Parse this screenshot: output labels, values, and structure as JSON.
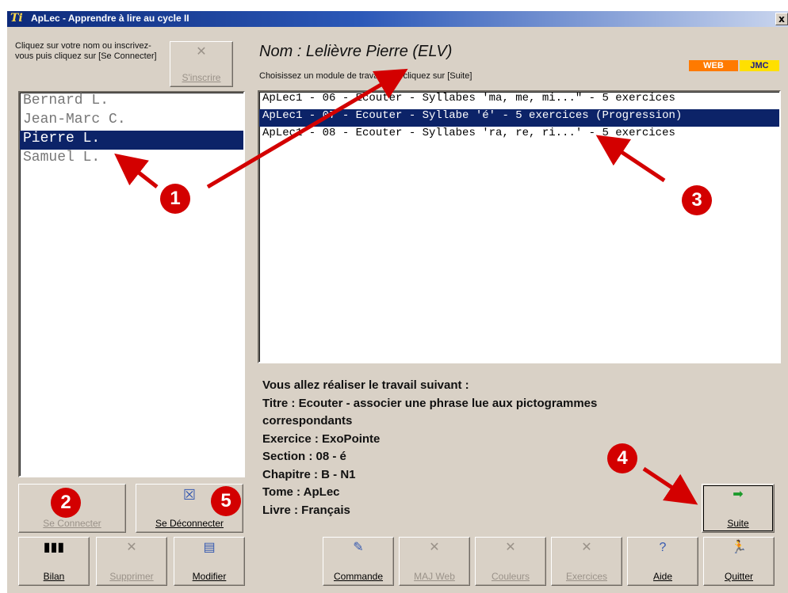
{
  "window": {
    "title": "ApLec - Apprendre à lire au cycle II",
    "close": "x"
  },
  "left_panel": {
    "instruction": "Cliquez sur votre nom ou inscrivez-vous puis cliquez sur [Se Connecter]",
    "inscrire_button": "S'inscrire",
    "users": [
      "Bernard L.",
      "Jean-Marc C.",
      "Pierre L.",
      "Samuel L."
    ],
    "selected_index": 2,
    "connect_button": "Se Connecter",
    "disconnect_button": "Se Déconnecter"
  },
  "header": {
    "nom": "Nom : Lelièvre Pierre (ELV)",
    "instruction": "Choisissez un module de travail puis cliquez sur [Suite]",
    "badge_web": "WEB",
    "badge_jmc": "JMC"
  },
  "modules": {
    "items": [
      "ApLec1 - 06 - Ecouter - Syllabes 'ma, me, mi...\" - 5 exercices",
      "ApLec1 - 07 - Ecouter - Syllabe 'é' - 5 exercices (Progression)",
      "ApLec1 - 08 - Ecouter - Syllabes 'ra, re, ri...' - 5 exercices"
    ],
    "selected_index": 1
  },
  "details": {
    "intro": "Vous allez réaliser le travail suivant :",
    "titre_line1": "Titre : Ecouter - associer une phrase lue aux pictogrammes",
    "titre_line2": "correspondants",
    "exercice": "Exercice : ExoPointe",
    "section": "Section : 08 - é",
    "chapitre": "Chapitre : B - N1",
    "tome": "Tome : ApLec",
    "livre": "Livre : Français"
  },
  "toolbar_left": {
    "bilan": "Bilan",
    "supprimer": "Supprimer",
    "modifier": "Modifier"
  },
  "toolbar_right": {
    "commande": "Commande",
    "maj_web": "MAJ Web",
    "couleurs": "Couleurs",
    "exercices": "Exercices",
    "aide": "Aide",
    "quitter": "Quitter"
  },
  "suite_button": "Suite",
  "callouts": [
    "1",
    "2",
    "3",
    "4",
    "5"
  ],
  "colors": {
    "window_bg": "#d9d1c6",
    "selection": "#0c2368",
    "callout": "#d30000"
  }
}
